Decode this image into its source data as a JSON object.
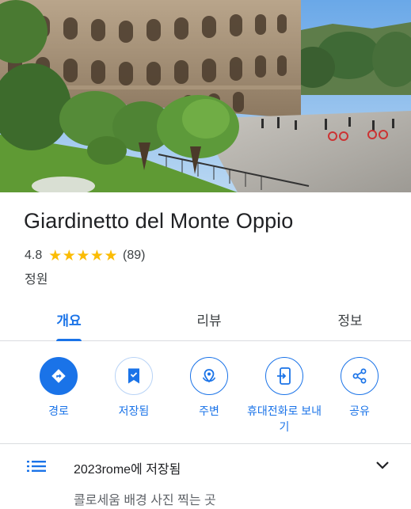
{
  "place": {
    "name": "Giardinetto del Monte Oppio",
    "rating": "4.8",
    "stars": "★★★★★",
    "review_count": "(89)",
    "category": "정원"
  },
  "tabs": [
    {
      "label": "개요",
      "active": true
    },
    {
      "label": "리뷰",
      "active": false
    },
    {
      "label": "정보",
      "active": false
    }
  ],
  "actions": [
    {
      "label": "경로",
      "icon": "directions-icon"
    },
    {
      "label": "저장됨",
      "icon": "bookmark-icon"
    },
    {
      "label": "주변",
      "icon": "nearby-icon"
    },
    {
      "label": "휴대전화로 보내기",
      "icon": "send-to-phone-icon"
    },
    {
      "label": "공유",
      "icon": "share-icon"
    }
  ],
  "saved_list": {
    "title": "2023rome에 저장됨",
    "note": "콜로세움 배경 사진 찍는 곳"
  },
  "colors": {
    "accent": "#1a73e8",
    "star": "#fbbc04",
    "text": "#202124",
    "secondary": "#3c4043",
    "divider": "#dadce0"
  }
}
